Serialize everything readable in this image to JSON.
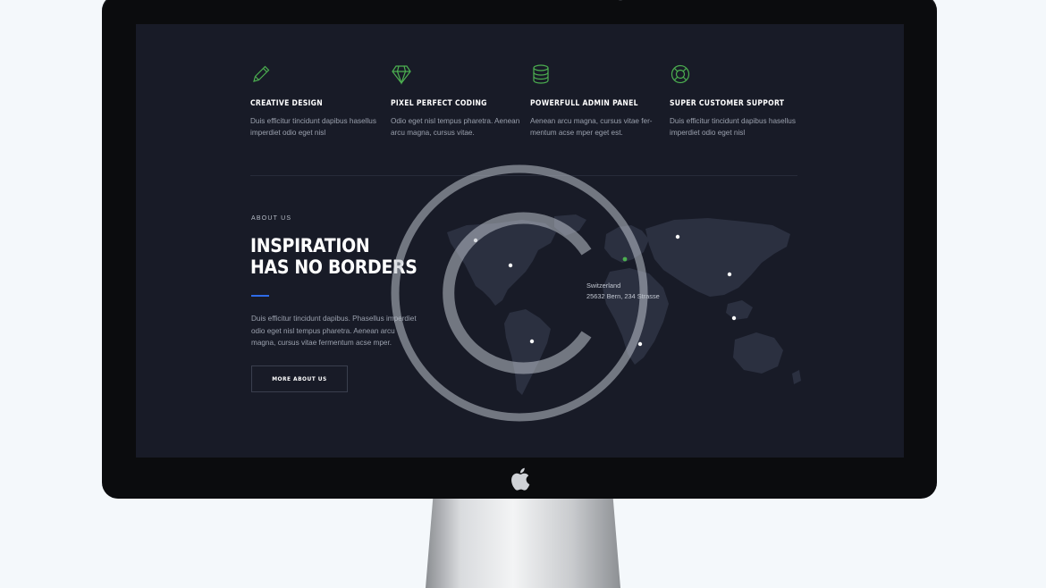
{
  "features": [
    {
      "icon": "pencil-icon",
      "title": "CREATIVE DESIGN",
      "text": "Duis efficitur tincidunt dapibus hasellus imperdiet odio eget nisl"
    },
    {
      "icon": "diamond-icon",
      "title": "PIXEL PERFECT CODING",
      "text": "Odio eget nisl tempus pharetra. Aenean arcu magna, cursus vitae."
    },
    {
      "icon": "database-icon",
      "title": "POWERFULL ADMIN PANEL",
      "text": "Aenean arcu magna, cursus vitae fer-mentum acse mper eget est."
    },
    {
      "icon": "lifebuoy-icon",
      "title": "SUPER CUSTOMER SUPPORT",
      "text": "Duis efficitur tincidunt dapibus hasellus imperdiet odio eget nisl"
    }
  ],
  "about": {
    "label": "ABOUT US",
    "title_line1": "INSPIRATION",
    "title_line2": "HAS NO BORDERS",
    "text": "Duis efficitur tincidunt dapibus. Phasellus imperdiet odio eget nisl tempus pharetra. Aenean arcu magna, cursus vitae fermentum acse mper.",
    "button_label": "MORE ABOUT US"
  },
  "map": {
    "location_name": "Switzerland",
    "location_address": "25632 Bern, 234 Strasse"
  },
  "colors": {
    "screen_bg": "#181b27",
    "accent_blue": "#2e6be8",
    "icon_green": "#4caf50",
    "text_muted": "#9aa0ad"
  },
  "overlay": {
    "icon": "copyright-watermark-icon"
  },
  "device": {
    "logo": "apple-logo-icon"
  }
}
